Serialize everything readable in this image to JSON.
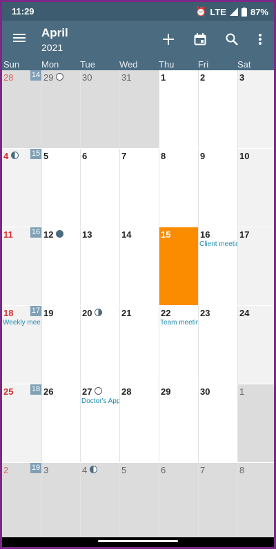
{
  "status_bar": {
    "time": "11:29",
    "network": "LTE",
    "battery": "87%"
  },
  "app_bar": {
    "month": "April",
    "year": "2021"
  },
  "weekdays": [
    "Sun",
    "Mon",
    "Tue",
    "Wed",
    "Thu",
    "Fri",
    "Sat"
  ],
  "weeks": [
    {
      "week_no": "14",
      "days": [
        {
          "n": "28",
          "other": true
        },
        {
          "n": "29",
          "other": true,
          "moon": "full"
        },
        {
          "n": "30",
          "other": true
        },
        {
          "n": "31",
          "other": true
        },
        {
          "n": "1"
        },
        {
          "n": "2"
        },
        {
          "n": "3"
        }
      ]
    },
    {
      "week_no": "15",
      "days": [
        {
          "n": "4",
          "moon": "last"
        },
        {
          "n": "5"
        },
        {
          "n": "6"
        },
        {
          "n": "7"
        },
        {
          "n": "8"
        },
        {
          "n": "9"
        },
        {
          "n": "10"
        }
      ]
    },
    {
      "week_no": "16",
      "days": [
        {
          "n": "11"
        },
        {
          "n": "12",
          "moon": "new"
        },
        {
          "n": "13"
        },
        {
          "n": "14"
        },
        {
          "n": "15",
          "today": true
        },
        {
          "n": "16",
          "event": "Client meeting"
        },
        {
          "n": "17"
        }
      ]
    },
    {
      "week_no": "17",
      "days": [
        {
          "n": "18",
          "event": "Weekly meeting"
        },
        {
          "n": "19"
        },
        {
          "n": "20",
          "moon": "first"
        },
        {
          "n": "21"
        },
        {
          "n": "22",
          "event": "Team meeting"
        },
        {
          "n": "23"
        },
        {
          "n": "24"
        }
      ]
    },
    {
      "week_no": "18",
      "days": [
        {
          "n": "25"
        },
        {
          "n": "26"
        },
        {
          "n": "27",
          "moon": "full",
          "event": "Doctor's Appointment"
        },
        {
          "n": "28"
        },
        {
          "n": "29"
        },
        {
          "n": "30"
        },
        {
          "n": "1",
          "other": true
        }
      ]
    },
    {
      "week_no": "19",
      "days": [
        {
          "n": "2",
          "other": true
        },
        {
          "n": "3",
          "other": true
        },
        {
          "n": "4",
          "other": true,
          "moon": "last"
        },
        {
          "n": "5",
          "other": true
        },
        {
          "n": "6",
          "other": true
        },
        {
          "n": "7",
          "other": true
        },
        {
          "n": "8",
          "other": true
        }
      ]
    }
  ],
  "icons": {
    "menu": "hamburger-menu-icon",
    "add": "plus-icon",
    "today": "calendar-today-icon",
    "search": "search-icon",
    "more": "more-vert-icon"
  },
  "colors": {
    "app_bar": "#4b6b80",
    "today": "#fb8c00",
    "sunday": "#d42d2d",
    "event": "#1f8bb0"
  }
}
